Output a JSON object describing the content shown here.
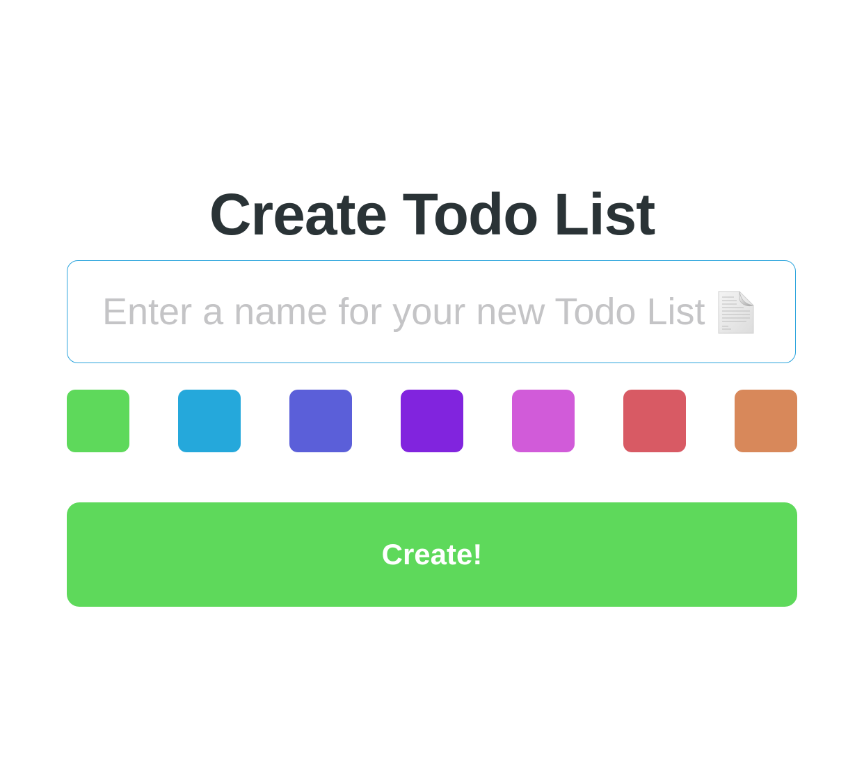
{
  "title": "Create Todo List",
  "name_input": {
    "value": "",
    "placeholder": "Enter a name for your new Todo List",
    "icon": "document-icon"
  },
  "swatches": [
    {
      "name": "green",
      "color": "#5ed95b"
    },
    {
      "name": "blue",
      "color": "#25a8db"
    },
    {
      "name": "indigo",
      "color": "#5b5fd9"
    },
    {
      "name": "purple",
      "color": "#8124de"
    },
    {
      "name": "pink",
      "color": "#d15bd9"
    },
    {
      "name": "red",
      "color": "#d85a64"
    },
    {
      "name": "orange",
      "color": "#d8885a"
    }
  ],
  "create_button": {
    "label": "Create!",
    "color": "#5ed95b"
  }
}
